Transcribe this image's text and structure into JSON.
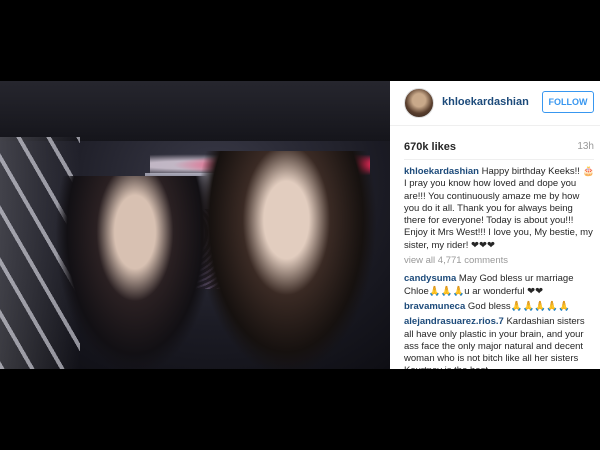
{
  "post": {
    "username": "khloekardashian",
    "follow_label": "FOLLOW",
    "likes": "670k likes",
    "time": "13h",
    "caption_user": "khloekardashian",
    "caption_text": "Happy birthday Keeks!! 🎂 I pray you know how loved and dope you are!!! You continuously amaze me by how you do it all. Thank you for always being there for everyone! Today is about you!!! Enjoy it Mrs West!!! I love you, My bestie, my sister, my rider! ❤❤❤",
    "view_all": "view all 4,771 comments",
    "comments": [
      {
        "user": "candysuma",
        "text": "May God bless ur marriage Chloe🙏🙏🙏u ar wonderful ❤❤"
      },
      {
        "user": "bravamuneca",
        "text": "God bless🙏🙏🙏🙏🙏"
      },
      {
        "user": "alejandrasuarez.rios.7",
        "text": "Kardashian sisters all have only plastic in your brain, and your ass face the only major natural and decent woman who is not bitch like all her sisters Kourtney is the best"
      }
    ]
  },
  "icons": {
    "avatar": "profile-avatar"
  },
  "colors": {
    "username": "#1c4a7a",
    "follow": "#3897f0",
    "muted": "#999999"
  }
}
